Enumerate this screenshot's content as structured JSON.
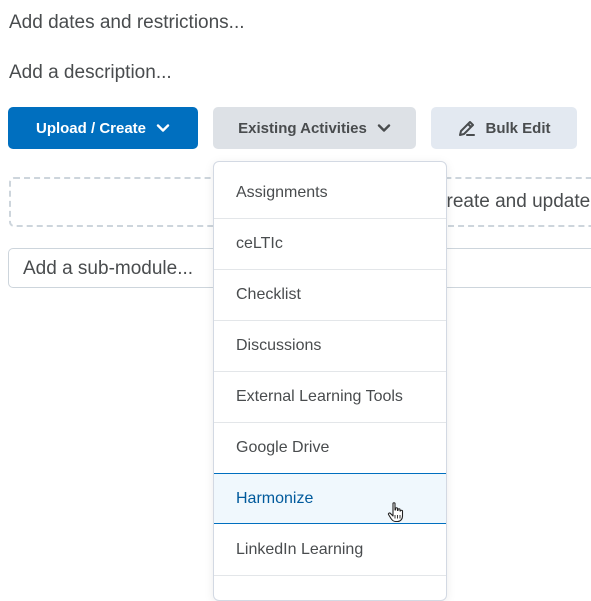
{
  "links": {
    "dates": "Add dates and restrictions...",
    "description": "Add a description..."
  },
  "toolbar": {
    "upload_create": "Upload / Create",
    "existing_activities": "Existing Activities",
    "bulk_edit": "Bulk Edit"
  },
  "dropzone": {
    "text": "create and update"
  },
  "submodule": {
    "placeholder": "Add a sub-module..."
  },
  "menu": {
    "items": [
      {
        "label": "Assignments"
      },
      {
        "label": "ceLTIc"
      },
      {
        "label": "Checklist"
      },
      {
        "label": "Discussions"
      },
      {
        "label": "External Learning Tools"
      },
      {
        "label": "Google Drive"
      },
      {
        "label": "Harmonize",
        "highlighted": true
      },
      {
        "label": "LinkedIn Learning"
      }
    ]
  },
  "icons": {
    "chevron": "chevron-down-icon",
    "pencil": "pencil-icon",
    "cursor": "hand-cursor-icon"
  },
  "colors": {
    "primary": "#006fbf",
    "secondary_button": "#dde1e6",
    "highlight_bg": "#f0f8fd",
    "highlight_text": "#005a9c"
  }
}
